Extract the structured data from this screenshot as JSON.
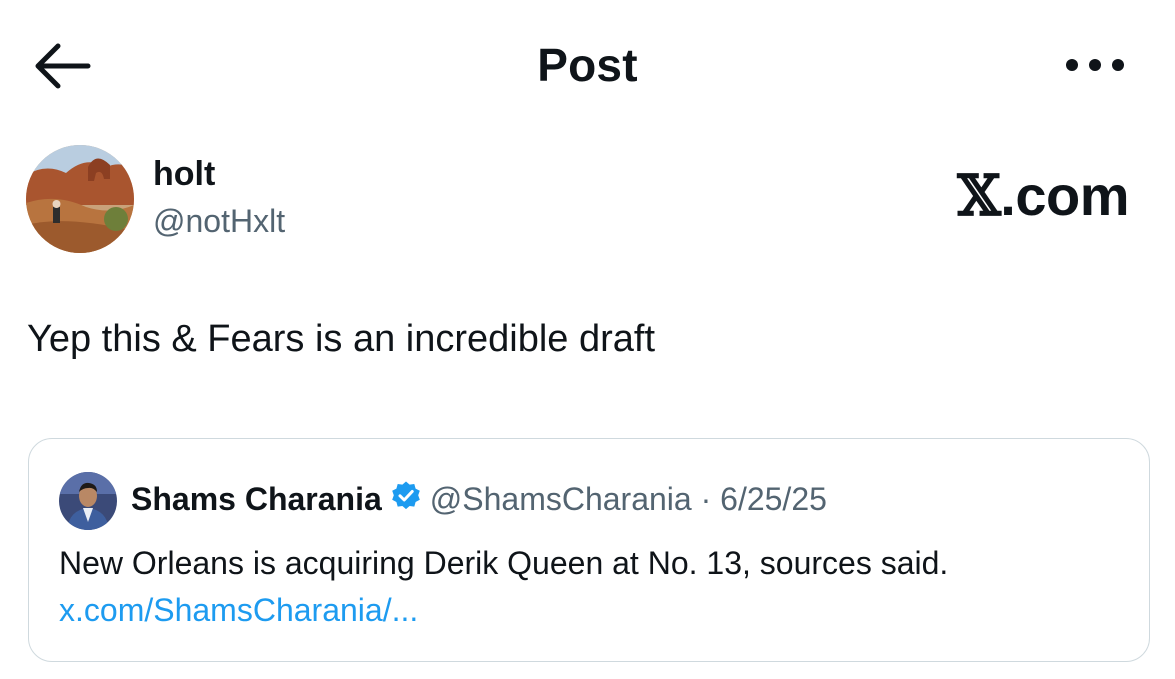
{
  "header": {
    "title": "Post",
    "back_icon": "arrow-left-icon",
    "more_icon": "more-horizontal-icon"
  },
  "author": {
    "name": "holt",
    "handle": "@notHxlt"
  },
  "brand": {
    "x": "𝕏",
    "domain": ".com"
  },
  "post": {
    "text": "Yep this & Fears is an incredible draft"
  },
  "quote": {
    "name": "Shams Charania",
    "verified": true,
    "handle": "@ShamsCharania",
    "separator": "·",
    "date": "6/25/25",
    "text": "New Orleans is acquiring Derik Queen at No. 13, sources said.",
    "link": "x.com/ShamsCharania/..."
  },
  "colors": {
    "text": "#0f1419",
    "secondary": "#536471",
    "link": "#1d9bf0",
    "verified": "#1d9bf0",
    "border": "#cfd9de"
  }
}
